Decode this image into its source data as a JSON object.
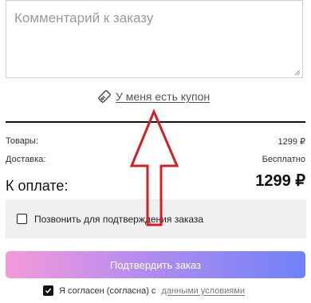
{
  "comment": {
    "placeholder": "Комментарий к заказу",
    "value": ""
  },
  "coupon": {
    "label": "У меня есть купон",
    "icon": "coupon-tag-icon"
  },
  "summary": {
    "goods_label": "Товары:",
    "goods_value": "1299 ₽",
    "delivery_label": "Доставка:",
    "delivery_value": "Бесплатно",
    "total_label": "К оплате:",
    "total_value": "1299 ₽"
  },
  "callback": {
    "label": "Позвонить для подтверждения заказа",
    "checked": false
  },
  "confirm": {
    "label": "Подтвердить заказ"
  },
  "agreement": {
    "checked": true,
    "text": "Я согласен (согласна) с",
    "link": "данными условиями"
  },
  "colors": {
    "annotation_arrow": "#d41f26",
    "button_gradient_start": "#f59ad8",
    "button_gradient_end": "#6f82f7"
  }
}
